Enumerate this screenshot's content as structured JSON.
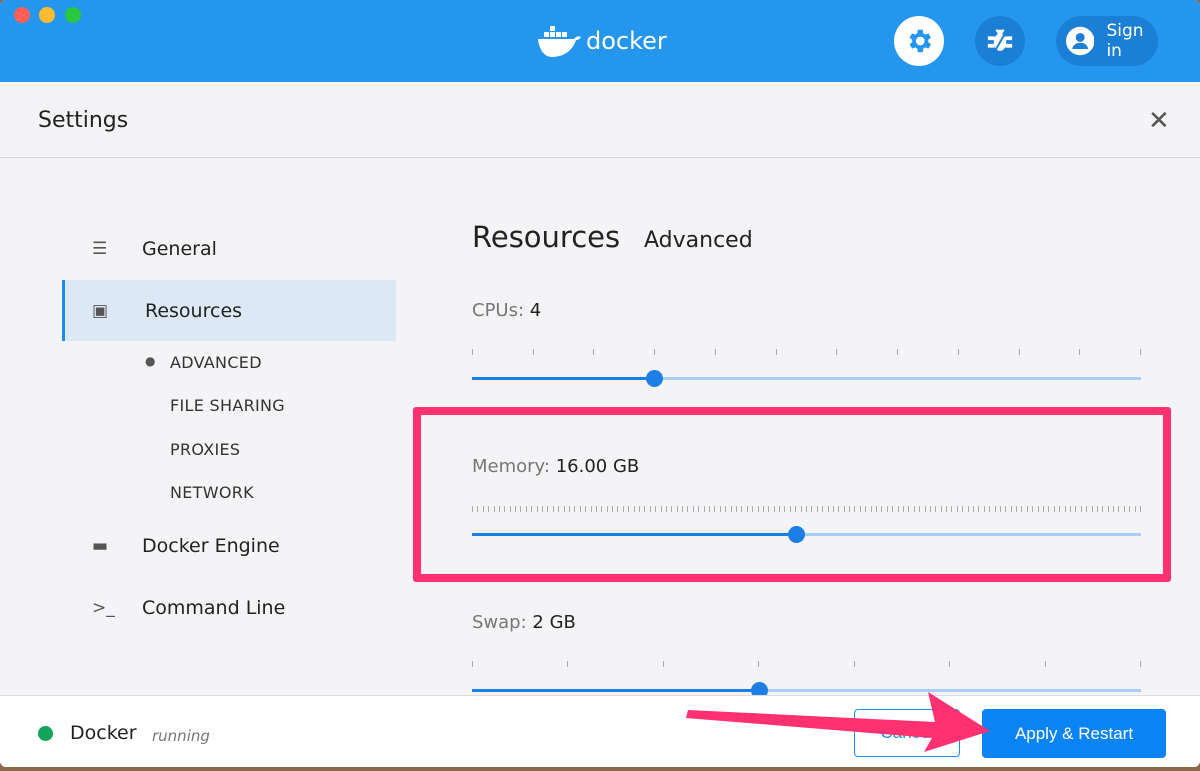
{
  "header": {
    "logo_text": "docker",
    "signin_label": "Sign in"
  },
  "settings": {
    "title": "Settings"
  },
  "sidebar": {
    "items": [
      {
        "label": "General"
      },
      {
        "label": "Resources"
      },
      {
        "label": "Docker Engine"
      },
      {
        "label": "Command Line"
      }
    ],
    "subitems": [
      {
        "label": "ADVANCED"
      },
      {
        "label": "FILE SHARING"
      },
      {
        "label": "PROXIES"
      },
      {
        "label": "NETWORK"
      }
    ]
  },
  "main": {
    "title": "Resources",
    "subtitle": "Advanced",
    "cpus": {
      "label": "CPUs:",
      "value": "4",
      "min": 1,
      "max": 12,
      "current": 4
    },
    "memory": {
      "label": "Memory:",
      "value": "16.00 GB",
      "min_gb": 1,
      "max_gb": 32,
      "current_gb": 16
    },
    "swap": {
      "label": "Swap:",
      "value": "2 GB",
      "min_gb": 0.5,
      "max_gb": 4,
      "current_gb": 2
    }
  },
  "footer": {
    "app": "Docker",
    "status": "running",
    "cancel_label": "Cancel",
    "apply_label": "Apply & Restart"
  },
  "colors": {
    "brand": "#2496ed",
    "accent": "#0a84f5",
    "highlight": "#ff3170",
    "status": "#12a55a"
  }
}
